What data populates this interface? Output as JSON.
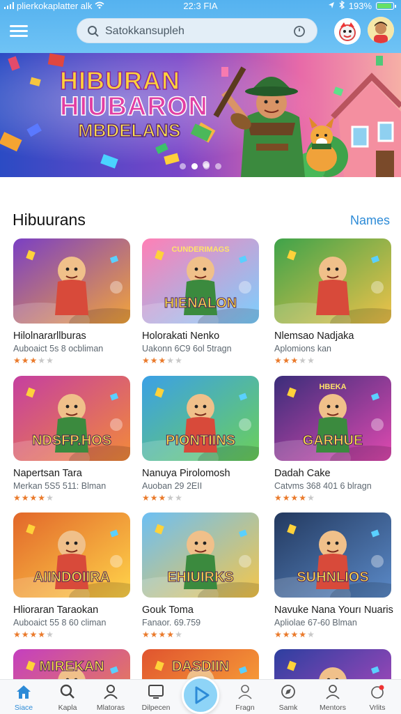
{
  "status_bar": {
    "carrier": "plierkokaplatter alk",
    "time": "22:3 FIA",
    "battery": "193%",
    "battery_level": 0.93
  },
  "search": {
    "placeholder": "Satokkansupleh"
  },
  "banner": {
    "line1": "HIBURAN",
    "line2": "HIUBARON",
    "line3": "MBDELANS",
    "slide_count": 4,
    "active_slide": 1
  },
  "section": {
    "title": "Hibuurans",
    "link": "Names"
  },
  "cards": [
    {
      "title": "Hilolnararllburas",
      "subtitle": "Auboaict 5s 8 ocbliman",
      "rating": 3,
      "thumb_text": "",
      "thumb_sub": "",
      "palette": [
        "#7a3fc4",
        "#f2a43b"
      ]
    },
    {
      "title": "Holorakati Nenko",
      "subtitle": "Uakonn 6C9 6ol 5tragn",
      "rating": 3,
      "thumb_text": "HIENALON",
      "thumb_sub": "CUNDERIMAGS",
      "palette": [
        "#ff7fb5",
        "#7bd0ff"
      ]
    },
    {
      "title": "Nlemsao Nadjaka",
      "subtitle": "Aplomions kan",
      "rating": 3,
      "thumb_text": "",
      "thumb_sub": "",
      "palette": [
        "#3ea34a",
        "#f0c24a"
      ]
    },
    {
      "title": "Napertsan Tara",
      "subtitle": "Merkan 5S5 511: Blman",
      "rating": 4,
      "thumb_text": "NDSFP.HOS",
      "thumb_sub": "",
      "palette": [
        "#c53fa0",
        "#f28a3a"
      ]
    },
    {
      "title": "Nanuya Pirolomosh",
      "subtitle": "Auoban 29 2EII",
      "rating": 3,
      "thumb_text": "PIONTIINS",
      "thumb_sub": "",
      "palette": [
        "#3ba0e6",
        "#6cd05a"
      ]
    },
    {
      "title": "Dadah Cake",
      "subtitle": "Catvms 368 401 6 blragn",
      "rating": 4,
      "thumb_text": "GARHUE",
      "thumb_sub": "HBEKA",
      "palette": [
        "#3a2d7a",
        "#e04ab0"
      ]
    },
    {
      "title": "Hlioraran Taraokan",
      "subtitle": "Auboaict 55 8 60 climan",
      "rating": 4,
      "thumb_text": "AIINDOIIRA",
      "thumb_sub": "",
      "palette": [
        "#e2672a",
        "#ffd44a"
      ]
    },
    {
      "title": "Gouk Toma",
      "subtitle": "Fanaor. 69.759",
      "rating": 4,
      "thumb_text": "EHIUIRKS",
      "thumb_sub": "",
      "palette": [
        "#6cbff4",
        "#f5c64a"
      ]
    },
    {
      "title": "Navuke  Nana Yourı Nuaris",
      "subtitle": "Apliolae 67-60 Blman",
      "rating": 4,
      "thumb_text": "SUHNLIOS",
      "thumb_sub": "",
      "palette": [
        "#23395f",
        "#5b8ac8"
      ]
    },
    {
      "title": "",
      "subtitle": "",
      "rating": 0,
      "thumb_text": "MIREKAN",
      "thumb_sub": "",
      "palette": [
        "#c43fc0",
        "#f08d3b"
      ]
    },
    {
      "title": "",
      "subtitle": "",
      "rating": 0,
      "thumb_text": "DASDIIN",
      "thumb_sub": "",
      "palette": [
        "#e0542f",
        "#ffb83a"
      ]
    },
    {
      "title": "",
      "subtitle": "",
      "rating": 0,
      "thumb_text": "",
      "thumb_sub": "",
      "palette": [
        "#2d3fa0",
        "#c24ac0"
      ]
    }
  ],
  "bottom_nav": [
    {
      "label": "Siace",
      "icon": "home-icon",
      "active": true
    },
    {
      "label": "Kapla",
      "icon": "search-icon",
      "active": false
    },
    {
      "label": "Mlatoras",
      "icon": "person-icon",
      "active": false
    },
    {
      "label": "Dilpecen",
      "icon": "screen-icon",
      "active": false
    },
    {
      "label": "",
      "icon": "play-icon",
      "active": false
    },
    {
      "label": "Fragn",
      "icon": "user-outline-icon",
      "active": false
    },
    {
      "label": "Samk",
      "icon": "compass-icon",
      "active": false
    },
    {
      "label": "Mentors",
      "icon": "people-icon",
      "active": false
    },
    {
      "label": "Vrlits",
      "icon": "notification-icon",
      "active": false
    }
  ],
  "colors": {
    "header": "#5fb9f2",
    "accent": "#2d8bd7",
    "star": "#ea7a2b",
    "banner_start": "#2b4bc4",
    "banner_end": "#f06aa5"
  }
}
